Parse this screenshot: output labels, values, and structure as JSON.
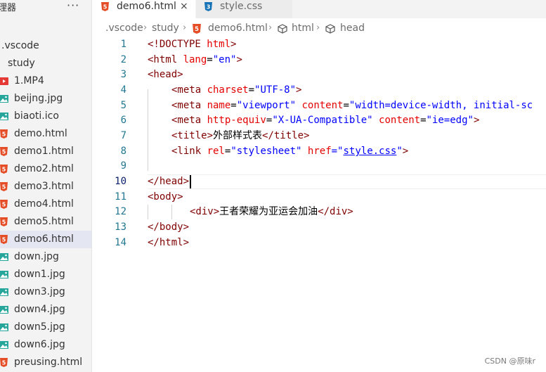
{
  "sidebar": {
    "title": "理器",
    "more_label": "···",
    "items": [
      {
        "label": ".vscode",
        "type": "folder"
      },
      {
        "label": "study",
        "type": "folder-sub"
      },
      {
        "label": "1.MP4",
        "type": "video"
      },
      {
        "label": "beijng.jpg",
        "type": "image"
      },
      {
        "label": "biaoti.ico",
        "type": "image"
      },
      {
        "label": "demo.html",
        "type": "html"
      },
      {
        "label": "demo1.html",
        "type": "html"
      },
      {
        "label": "demo2.html",
        "type": "html"
      },
      {
        "label": "demo3.html",
        "type": "html"
      },
      {
        "label": "demo4.html",
        "type": "html"
      },
      {
        "label": "demo5.html",
        "type": "html"
      },
      {
        "label": "demo6.html",
        "type": "html",
        "selected": true
      },
      {
        "label": "down.jpg",
        "type": "image"
      },
      {
        "label": "down1.jpg",
        "type": "image"
      },
      {
        "label": "down3.jpg",
        "type": "image"
      },
      {
        "label": "down4.jpg",
        "type": "image"
      },
      {
        "label": "down5.jpg",
        "type": "image"
      },
      {
        "label": "down6.jpg",
        "type": "image"
      },
      {
        "label": "preusing.html",
        "type": "html"
      }
    ]
  },
  "tabs": [
    {
      "label": "demo6.html",
      "icon": "html5-icon",
      "active": true,
      "close": "×"
    },
    {
      "label": "style.css",
      "icon": "css3-icon",
      "active": false
    }
  ],
  "breadcrumb": {
    "vscode": ".vscode",
    "study": "study",
    "file": "demo6.html",
    "html": "html",
    "head": "head",
    "separator": "›"
  },
  "editor": {
    "current_line": 10,
    "line_numbers": [
      "1",
      "2",
      "3",
      "4",
      "5",
      "6",
      "7",
      "8",
      "9",
      "10",
      "11",
      "12",
      "13",
      "14"
    ],
    "lines": {
      "l1": {
        "a": "<!DOCTYPE ",
        "b": "html",
        "c": ">"
      },
      "l2": {
        "a": "<html ",
        "b": "lang",
        "c": "=",
        "d": "\"en\"",
        "e": ">"
      },
      "l3": {
        "a": "<head>"
      },
      "l4": {
        "a": "<meta ",
        "b": "charset",
        "c": "=",
        "d": "\"UTF-8\"",
        "e": ">"
      },
      "l5": {
        "a": "<meta ",
        "b": "name",
        "c": "=",
        "d": "\"viewport\"",
        "e": " ",
        "f": "content",
        "g": "=",
        "h": "\"width=device-width, initial-sc"
      },
      "l6": {
        "a": "<meta ",
        "b": "http-equiv",
        "c": "=",
        "d": "\"X-UA-Compatible\"",
        "e": " ",
        "f": "content",
        "g": "=",
        "h": "\"ie=edg\"",
        "i": ">"
      },
      "l7": {
        "a": "<title>",
        "b": "外部样式表",
        "c": "</title>"
      },
      "l8": {
        "a": "<link ",
        "b": "rel",
        "c": "=",
        "d": "\"stylesheet\"",
        "e": " ",
        "f": "href",
        "g": "=\"",
        "h": "style.css",
        "i": "\"",
        "j": ">"
      },
      "l10": {
        "a": "</head>"
      },
      "l11": {
        "a": "<body>"
      },
      "l12": {
        "a": "<div>",
        "b": "王者荣耀为亚运会加油",
        "c": "</div>"
      },
      "l13": {
        "a": "</body>"
      },
      "l14": {
        "a": "</html>"
      }
    }
  },
  "watermark": "CSDN @原味r",
  "colors": {
    "tag": "#800000",
    "attribute": "#e50000",
    "value": "#0000ff",
    "line_number": "#237893",
    "html_icon": "#e44d26",
    "css_icon": "#1572b6",
    "image_icon": "#26a69a"
  }
}
